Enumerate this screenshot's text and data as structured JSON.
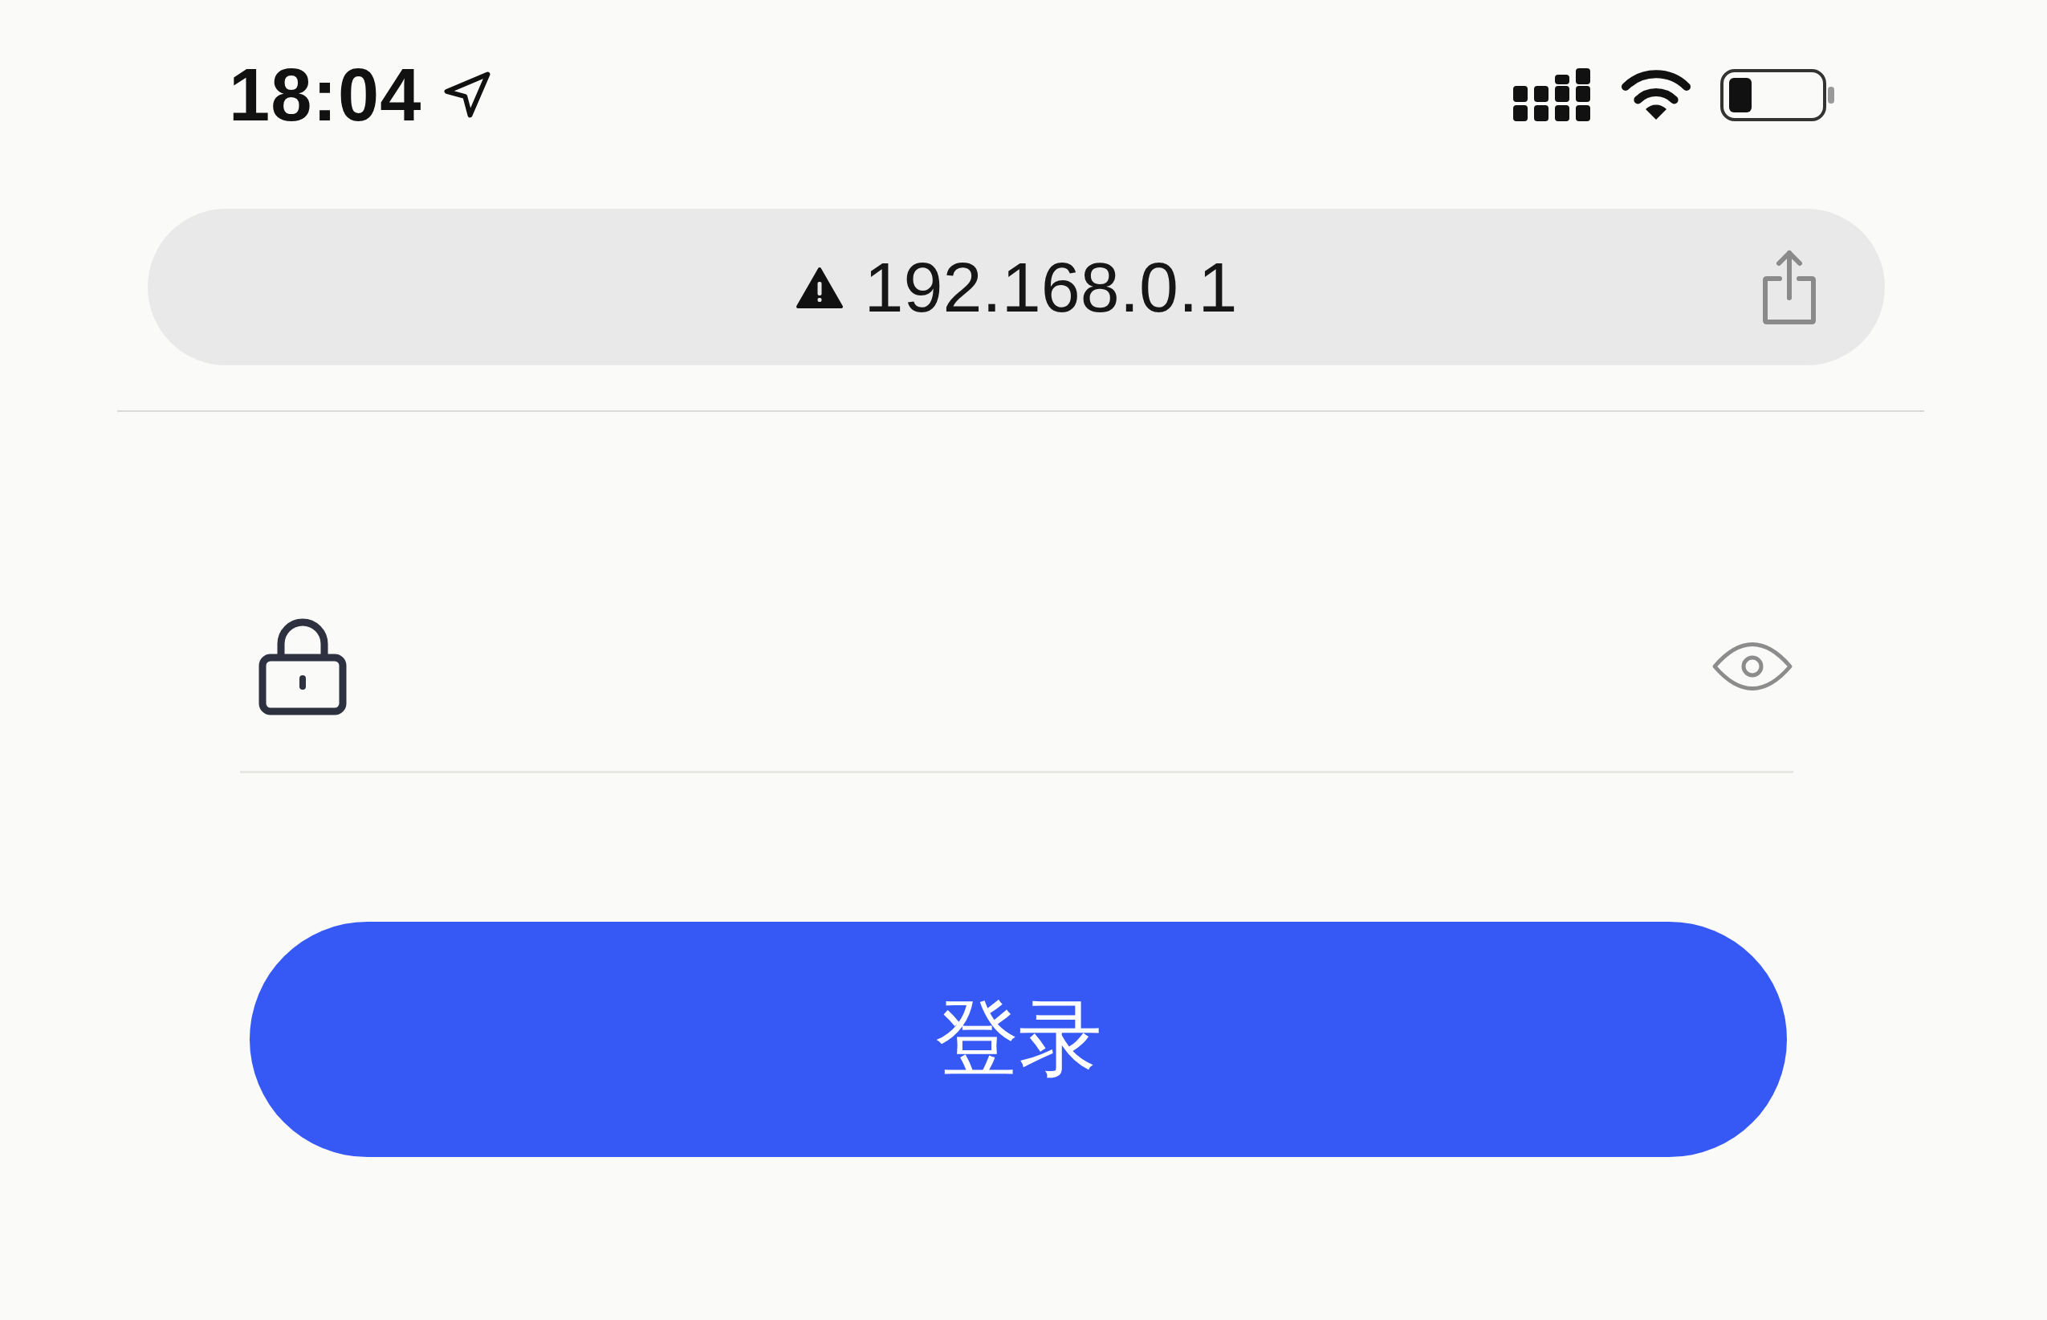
{
  "status_bar": {
    "time": "18:04"
  },
  "address_bar": {
    "url": "192.168.0.1"
  },
  "login_form": {
    "submit_button": "登录"
  }
}
